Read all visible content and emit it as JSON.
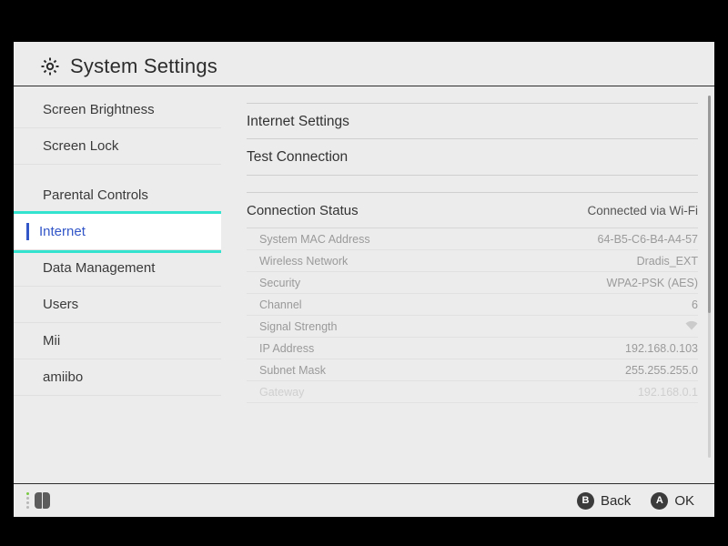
{
  "header": {
    "title": "System Settings"
  },
  "sidebar": {
    "items": [
      {
        "label": "Screen Brightness"
      },
      {
        "label": "Screen Lock"
      },
      {
        "label": "Parental Controls"
      },
      {
        "label": "Internet"
      },
      {
        "label": "Data Management"
      },
      {
        "label": "Users"
      },
      {
        "label": "Mii"
      },
      {
        "label": "amiibo"
      }
    ]
  },
  "panel": {
    "options": {
      "internet_settings": "Internet Settings",
      "test_connection": "Test Connection"
    },
    "status": {
      "title": "Connection Status",
      "value": "Connected via Wi-Fi",
      "rows": [
        {
          "k": "System MAC Address",
          "v": "64-B5-C6-B4-A4-57"
        },
        {
          "k": "Wireless Network",
          "v": "Dradis_EXT"
        },
        {
          "k": "Security",
          "v": "WPA2-PSK (AES)"
        },
        {
          "k": "Channel",
          "v": "6"
        },
        {
          "k": "Signal Strength",
          "v": ""
        },
        {
          "k": "IP Address",
          "v": "192.168.0.103"
        },
        {
          "k": "Subnet Mask",
          "v": "255.255.255.0"
        },
        {
          "k": "Gateway",
          "v": "192.168.0.1"
        }
      ]
    }
  },
  "footer": {
    "back": {
      "glyph": "B",
      "label": "Back"
    },
    "ok": {
      "glyph": "A",
      "label": "OK"
    }
  }
}
